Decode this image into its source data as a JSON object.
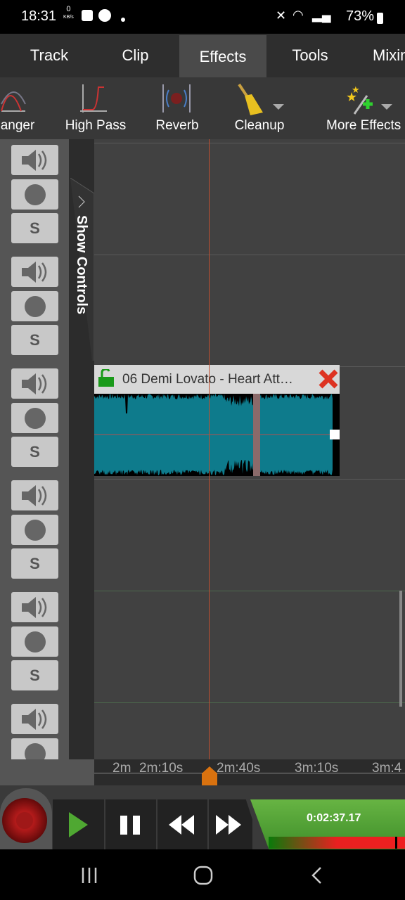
{
  "status": {
    "time": "18:31",
    "net_speed": "0",
    "net_unit": "KB/s",
    "battery": "73%"
  },
  "tabs": [
    {
      "label": "Track"
    },
    {
      "label": "Clip"
    },
    {
      "label": "Effects",
      "active": true
    },
    {
      "label": "Tools"
    },
    {
      "label": "Mixin"
    }
  ],
  "effects": [
    {
      "label": "anger",
      "icon": "flanger-icon"
    },
    {
      "label": "High Pass",
      "icon": "high-pass-icon"
    },
    {
      "label": "Reverb",
      "icon": "reverb-icon"
    },
    {
      "label": "Cleanup",
      "icon": "broom-icon"
    },
    {
      "label": "More Effects",
      "icon": "magic-wand-icon"
    }
  ],
  "show_controls": "Show Controls",
  "track_count": 6,
  "solo_label": "S",
  "clip": {
    "title": "06 Demi Lovato - Heart Att…",
    "color": "#0e7b8c"
  },
  "ruler": {
    "ticks": [
      "2m",
      "2m:10s",
      "2m:40s",
      "3m:10s",
      "3m:4"
    ]
  },
  "transport": {
    "time": "0:02:37.17"
  },
  "colors": {
    "accent_green": "#5aa73a",
    "playhead": "#d9720f",
    "record": "#8a1010"
  }
}
